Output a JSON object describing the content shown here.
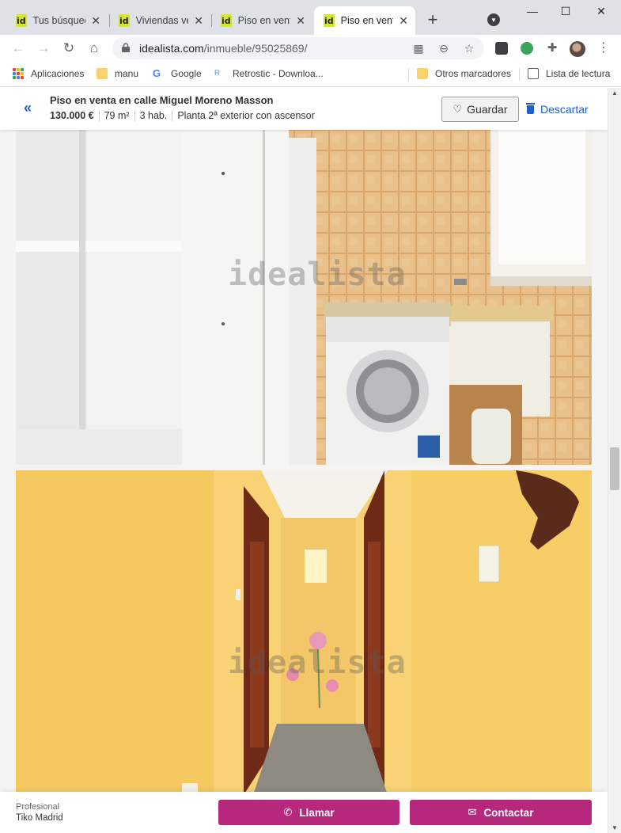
{
  "browser": {
    "tabs": [
      {
        "label": "Tus búsquedas",
        "favicon": "id",
        "active": false
      },
      {
        "label": "Viviendas venta",
        "favicon": "id",
        "active": false
      },
      {
        "label": "Piso en venta",
        "favicon": "id",
        "active": false
      },
      {
        "label": "Piso en venta",
        "favicon": "id",
        "active": true
      }
    ],
    "url_host": "idealista.com",
    "url_path": "/inmueble/95025869/",
    "bookmarks": [
      {
        "label": "Aplicaciones",
        "icon": "apps-grid-icon"
      },
      {
        "label": "manu",
        "icon": "folder-icon"
      },
      {
        "label": "Google",
        "icon": "google-icon"
      },
      {
        "label": "Retrostic - Downloa...",
        "icon": "retrostic-icon"
      },
      {
        "label": "Otros marcadores",
        "icon": "folder-icon"
      },
      {
        "label": "Lista de lectura",
        "icon": "reading-list-icon"
      }
    ],
    "colors": {
      "tabstrip": "#dee1e6",
      "omnibox": "#f1f3f4",
      "favicon": "#d7e52a"
    }
  },
  "listing": {
    "title": "Piso en venta en calle Miguel Moreno Masson",
    "price": "130.000 €",
    "area": "79 m²",
    "rooms": "3 hab.",
    "floor": "Planta 2ª exterior con ascensor",
    "save_label": "Guardar",
    "discard_label": "Descartar",
    "watermark": "idealista",
    "colors": {
      "link": "#1a62c7",
      "primary": "#b6287d"
    }
  },
  "contact": {
    "type": "Profesional",
    "agency": "Tiko Madrid",
    "call_label": "Llamar",
    "contact_label": "Contactar"
  }
}
